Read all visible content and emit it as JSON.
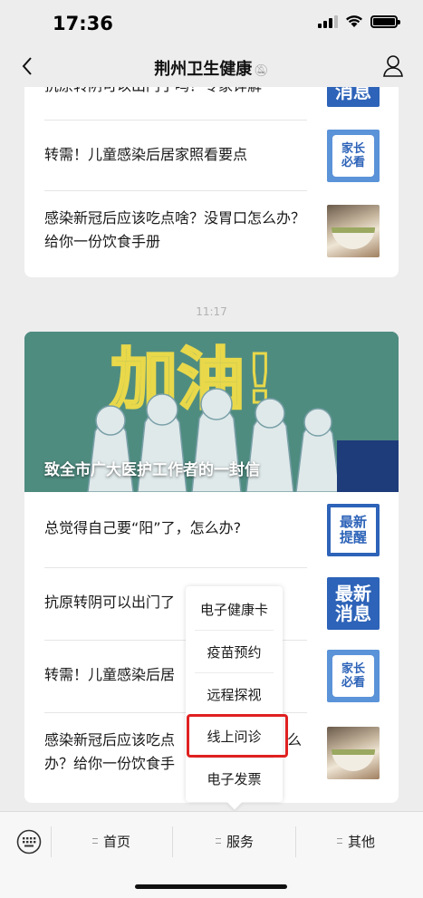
{
  "status_bar": {
    "time": "17:36"
  },
  "nav": {
    "title": "荆州卫生健康",
    "mute_icon": "bell-slash-icon"
  },
  "card1": {
    "partial_title": "抗原转阴可以出门了吗？专家详解",
    "partial_thumb_text": "消息",
    "items": [
      {
        "title": "转需！儿童感染后居家照看要点",
        "thumb_line1": "家长",
        "thumb_line2": "必看"
      },
      {
        "title": "感染新冠后应该吃点啥？没胃口怎么办？给你一份饮食手册"
      }
    ]
  },
  "timestamp": "11:17",
  "card2": {
    "banner_caption": "致全市广大医护工作者的一封信",
    "banner_art_text": "加油!",
    "items": [
      {
        "title": "总觉得自己要“阳”了，怎么办?",
        "thumb_line1": "最新",
        "thumb_line2": "提醒"
      },
      {
        "title": "抗原转阴可以出门了",
        "thumb_line1": "最新",
        "thumb_line2": "消息"
      },
      {
        "title": "转需！儿童感染后居",
        "thumb_line1": "家长",
        "thumb_line2": "必看"
      },
      {
        "title": "感染新冠后应该吃点",
        "title2": "办？给你一份饮食手",
        "title_end": "么"
      }
    ]
  },
  "popup_menu": {
    "items": [
      "电子健康卡",
      "疫苗预约",
      "远程探视",
      "线上问诊",
      "电子发票"
    ],
    "highlighted": "线上问诊",
    "highlight_color": "#e02020"
  },
  "bottom_menu": {
    "items": [
      "首页",
      "服务",
      "其他"
    ]
  }
}
